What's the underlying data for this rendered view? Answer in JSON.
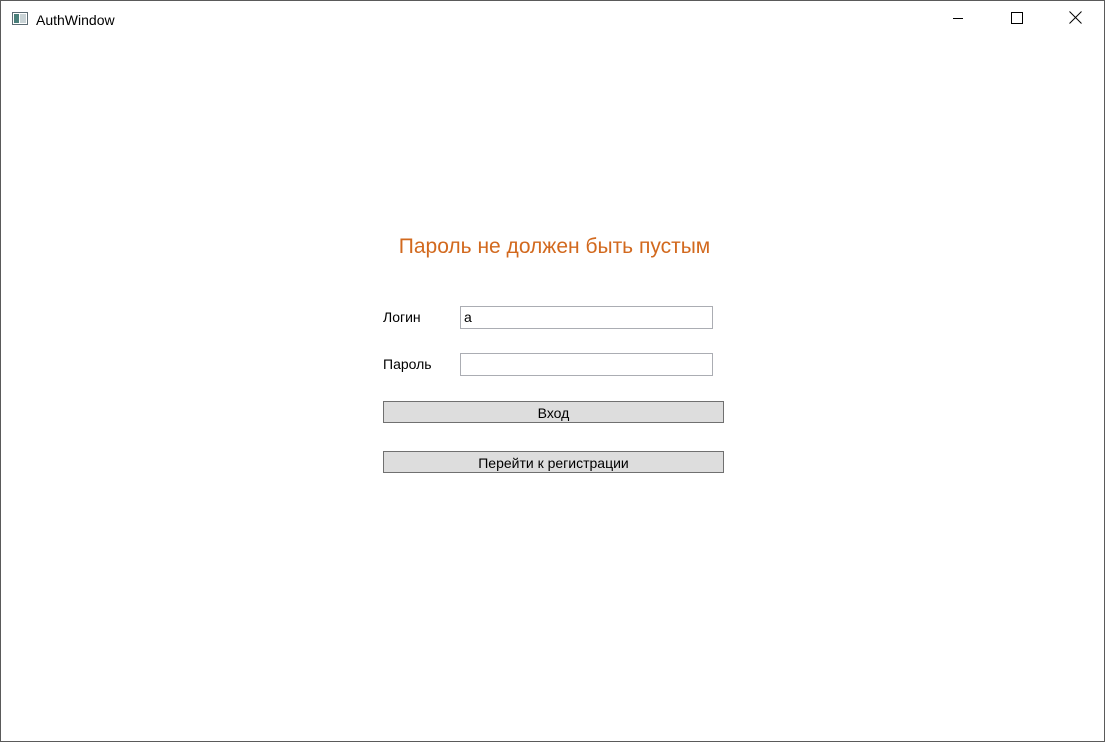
{
  "window": {
    "title": "AuthWindow",
    "icon": "app-window-icon",
    "controls": {
      "minimize_icon": "minimize-icon",
      "maximize_icon": "maximize-icon",
      "close_icon": "close-icon"
    }
  },
  "form": {
    "error_message": "Пароль не должен быть пустым",
    "error_color": "#d2691e",
    "login_label": "Логин",
    "login_value": "а",
    "password_label": "Пароль",
    "password_value": "",
    "enter_button": "Вход",
    "register_button": "Перейти к регистрации"
  }
}
